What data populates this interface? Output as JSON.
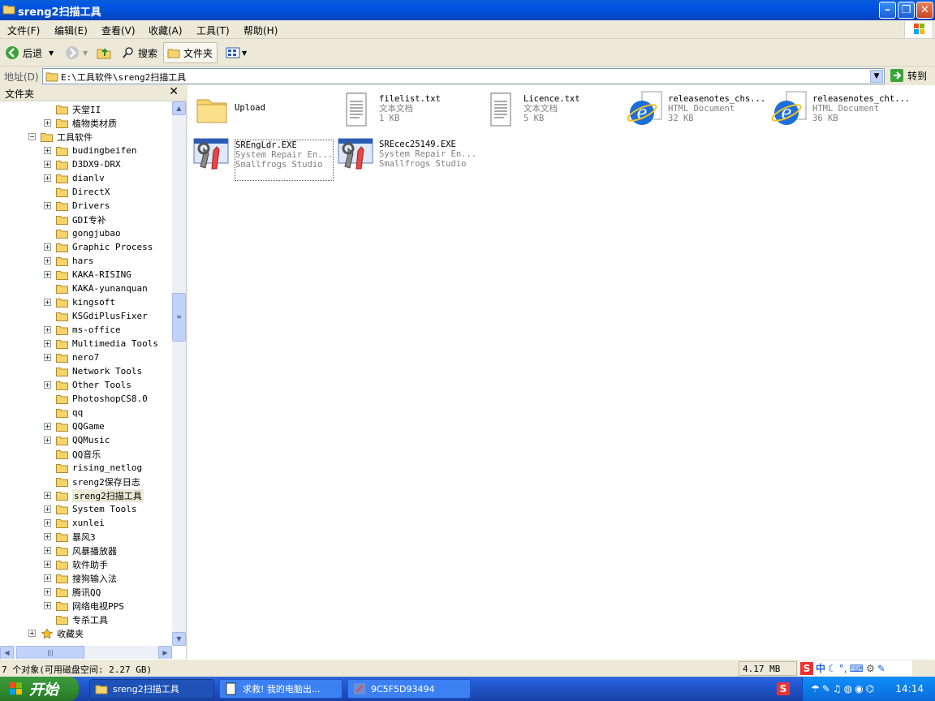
{
  "window": {
    "title": "sreng2扫描工具"
  },
  "menu": [
    "文件(F)",
    "编辑(E)",
    "查看(V)",
    "收藏(A)",
    "工具(T)",
    "帮助(H)"
  ],
  "toolbar": {
    "back": "后退",
    "search": "搜索",
    "folders": "文件夹"
  },
  "address": {
    "label": "地址(D)",
    "value": "E:\\工具软件\\sreng2扫描工具",
    "go": "转到"
  },
  "folder_pane": {
    "title": "文件夹",
    "tree": [
      {
        "label": "天堂II",
        "exp": "",
        "lvl": 2
      },
      {
        "label": "植物类材质",
        "exp": "+",
        "lvl": 2
      },
      {
        "label": "工具软件",
        "exp": "-",
        "lvl": 1
      },
      {
        "label": "budingbeifen",
        "exp": "+",
        "lvl": 2
      },
      {
        "label": "D3DX9-DRX",
        "exp": "+",
        "lvl": 2
      },
      {
        "label": "dianlv",
        "exp": "+",
        "lvl": 2
      },
      {
        "label": "DirectX",
        "exp": "",
        "lvl": 2
      },
      {
        "label": "Drivers",
        "exp": "+",
        "lvl": 2
      },
      {
        "label": "GDI专补",
        "exp": "",
        "lvl": 2
      },
      {
        "label": "gongjubao",
        "exp": "",
        "lvl": 2
      },
      {
        "label": "Graphic Process",
        "exp": "+",
        "lvl": 2
      },
      {
        "label": "hars",
        "exp": "+",
        "lvl": 2
      },
      {
        "label": "KAKA-RISING",
        "exp": "+",
        "lvl": 2
      },
      {
        "label": "KAKA-yunanquan",
        "exp": "",
        "lvl": 2
      },
      {
        "label": "kingsoft",
        "exp": "+",
        "lvl": 2
      },
      {
        "label": "KSGdiPlusFixer",
        "exp": "",
        "lvl": 2
      },
      {
        "label": "ms-office",
        "exp": "+",
        "lvl": 2
      },
      {
        "label": "Multimedia Tools",
        "exp": "+",
        "lvl": 2
      },
      {
        "label": "nero7",
        "exp": "+",
        "lvl": 2
      },
      {
        "label": "Network Tools",
        "exp": "",
        "lvl": 2
      },
      {
        "label": "Other Tools",
        "exp": "+",
        "lvl": 2
      },
      {
        "label": "PhotoshopCS8.0",
        "exp": "",
        "lvl": 2
      },
      {
        "label": "qq",
        "exp": "",
        "lvl": 2
      },
      {
        "label": "QQGame",
        "exp": "+",
        "lvl": 2
      },
      {
        "label": "QQMusic",
        "exp": "+",
        "lvl": 2
      },
      {
        "label": "QQ音乐",
        "exp": "",
        "lvl": 2
      },
      {
        "label": "rising_netlog",
        "exp": "",
        "lvl": 2
      },
      {
        "label": "sreng2保存日志",
        "exp": "",
        "lvl": 2
      },
      {
        "label": "sreng2扫描工具",
        "exp": "+",
        "lvl": 2,
        "sel": true
      },
      {
        "label": "System Tools",
        "exp": "+",
        "lvl": 2
      },
      {
        "label": "xunlei",
        "exp": "+",
        "lvl": 2
      },
      {
        "label": "暴风3",
        "exp": "+",
        "lvl": 2
      },
      {
        "label": "风暴播放器",
        "exp": "+",
        "lvl": 2
      },
      {
        "label": "软件助手",
        "exp": "+",
        "lvl": 2
      },
      {
        "label": "搜狗输入法",
        "exp": "+",
        "lvl": 2
      },
      {
        "label": "腾讯QQ",
        "exp": "+",
        "lvl": 2
      },
      {
        "label": "网络电视PPS",
        "exp": "+",
        "lvl": 2
      },
      {
        "label": "专杀工具",
        "exp": "",
        "lvl": 2
      },
      {
        "label": "收藏夹",
        "exp": "+",
        "lvl": 1,
        "star": true
      }
    ]
  },
  "files": [
    {
      "name": "Upload",
      "type": "folder"
    },
    {
      "name": "filelist.txt",
      "l2": "文本文档",
      "l3": "1 KB",
      "type": "txt"
    },
    {
      "name": "Licence.txt",
      "l2": "文本文档",
      "l3": "5 KB",
      "type": "txt"
    },
    {
      "name": "releasenotes_chs...",
      "l2": "HTML Document",
      "l3": "32 KB",
      "type": "html"
    },
    {
      "name": "releasenotes_cht...",
      "l2": "HTML Document",
      "l3": "36 KB",
      "type": "html"
    },
    {
      "name": "SREngLdr.EXE",
      "l2": "System Repair En...",
      "l3": "Smallfrogs Studio",
      "type": "exe",
      "sel": true
    },
    {
      "name": "SREcec25149.EXE",
      "l2": "System Repair En...",
      "l3": "Smallfrogs Studio",
      "type": "exe"
    }
  ],
  "status": {
    "left": "7 个对象(可用磁盘空间: 2.27 GB)",
    "size": "4.17 MB"
  },
  "taskbar": {
    "start": "开始",
    "tasks": [
      "sreng2扫描工具",
      "求救! 我的电脑出...",
      "9C5F5D93494"
    ],
    "clock": "14:14"
  },
  "ime": {
    "label": "中"
  }
}
